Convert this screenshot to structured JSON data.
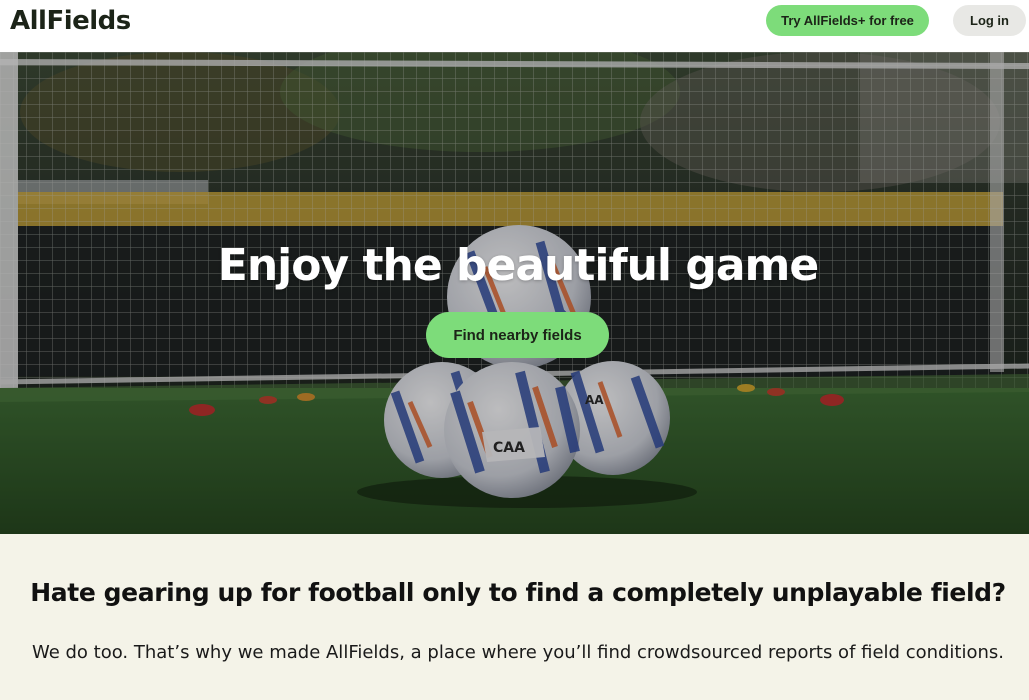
{
  "header": {
    "logo": "AllFields",
    "try_label": "Try AllFields+ for free",
    "login_label": "Log in"
  },
  "hero": {
    "title": "Enjoy the beautiful game",
    "cta_label": "Find nearby fields",
    "ball_print": "CAA",
    "ball_print_alt": "AA"
  },
  "info": {
    "title": "Hate gearing up for football only to find a completely unplayable field?",
    "body": "We do too. That’s why we made AllFields, a place where you’ll find crowdsourced reports of field conditions."
  },
  "colors": {
    "accent": "#7ddc7a",
    "section_bg": "#f4f3e8",
    "header_bg": "#ffffff"
  }
}
